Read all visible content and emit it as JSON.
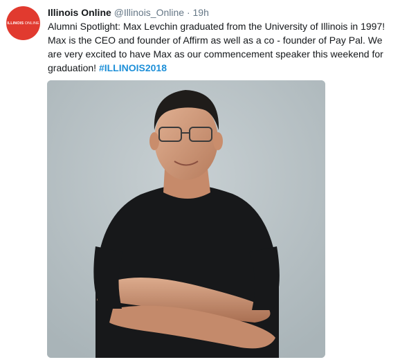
{
  "account": {
    "avatar_logo_bold": "ILLINOIS",
    "avatar_logo_light": "ONLINE",
    "name": "Illinois Online",
    "handle": "@Illinois_Online",
    "separator": "·",
    "time": "19h"
  },
  "tweet": {
    "text": "Alumni Spotlight: Max Levchin graduated from the University of Illinois in 1997! Max is the CEO and founder of Affirm as well as a co - founder of Pay Pal. We are very excited to have Max as our commencement speaker this weekend for graduation! ",
    "hashtag": "#ILLINOIS2018"
  },
  "media": {
    "icon": "photo",
    "background_color": "#b9c3c6"
  },
  "colors": {
    "brand_red": "#e13a2f",
    "link_blue": "#1d8fd8",
    "secondary_text": "#657786"
  }
}
